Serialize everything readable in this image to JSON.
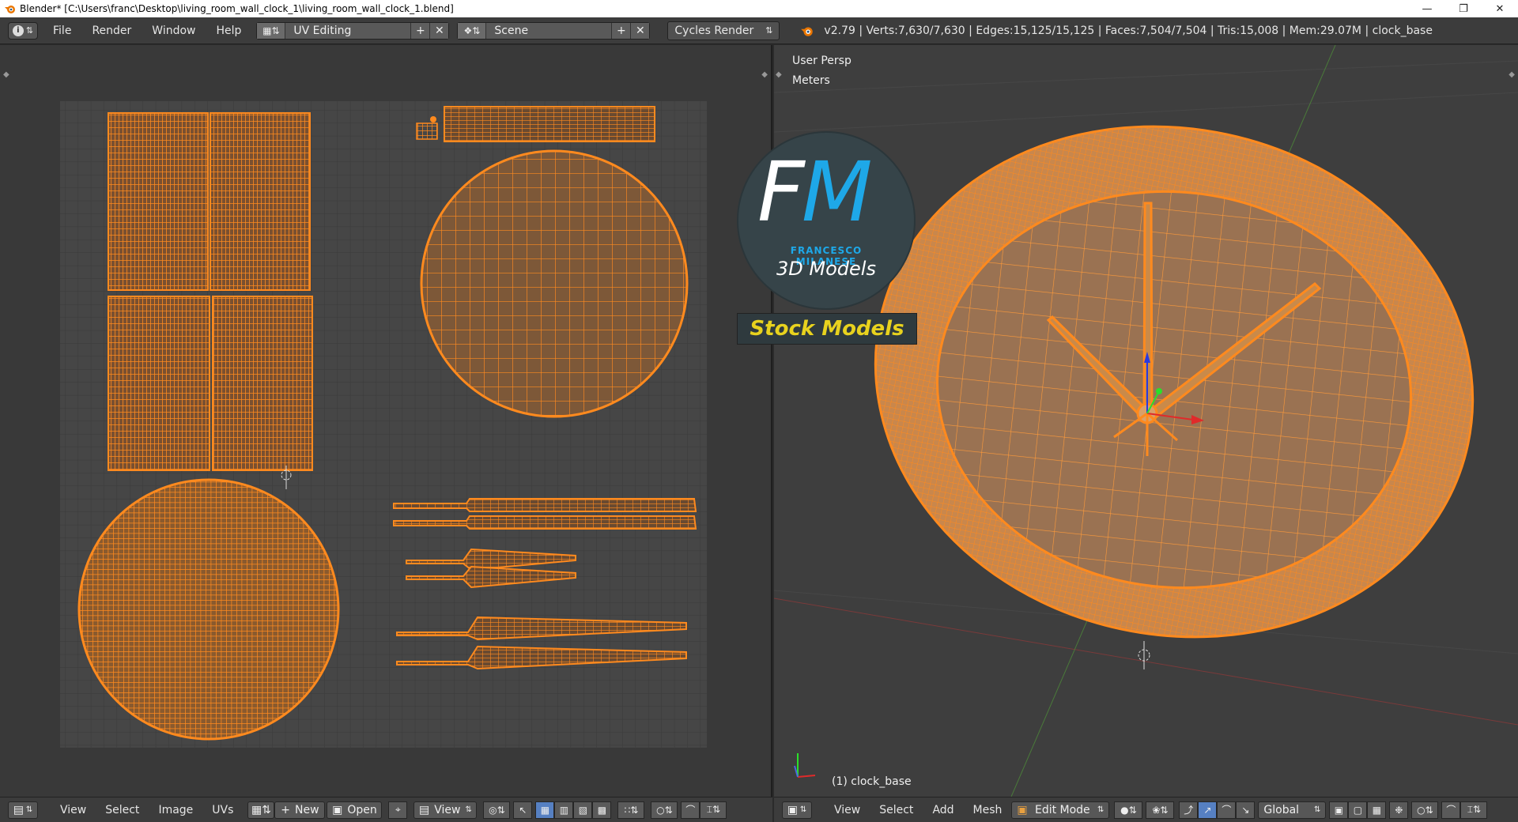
{
  "window": {
    "title": "Blender* [C:\\Users\\franc\\Desktop\\living_room_wall_clock_1\\living_room_wall_clock_1.blend]"
  },
  "info_header": {
    "menus": [
      "File",
      "Render",
      "Window",
      "Help"
    ],
    "screen_layout": "UV Editing",
    "scene": "Scene",
    "render_engine": "Cycles Render",
    "stats": "v2.79 | Verts:7,630/7,630 | Edges:15,125/15,125 | Faces:7,504/7,504 | Tris:15,008 | Mem:29.07M | clock_base"
  },
  "viewport": {
    "view_name": "User Persp",
    "units": "Meters",
    "object_label": "(1) clock_base"
  },
  "watermark": {
    "initials": "FM",
    "name": "FRANCESCO MILANESE",
    "sub": "3D Models",
    "banner": "Stock Models"
  },
  "uv_footer": {
    "menus": [
      "View",
      "Select",
      "Image",
      "UVs"
    ],
    "new_label": "New",
    "open_label": "Open",
    "view_label": "View"
  },
  "viewport_footer": {
    "menus": [
      "View",
      "Select",
      "Add",
      "Mesh"
    ],
    "mode": "Edit Mode",
    "orientation": "Global"
  },
  "colors": {
    "mesh_orange": "#ff8a1e",
    "uv_grid_bg": "#464646",
    "accent_blue": "#5680c2"
  }
}
